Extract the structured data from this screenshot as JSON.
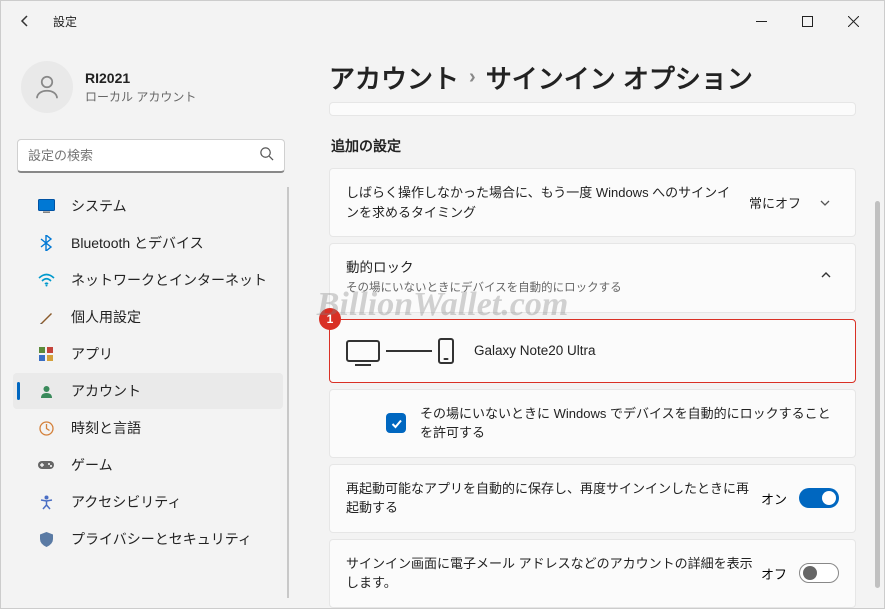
{
  "titlebar": {
    "title": "設定"
  },
  "profile": {
    "name": "RI2021",
    "type": "ローカル アカウント"
  },
  "search": {
    "placeholder": "設定の検索"
  },
  "nav": {
    "items": [
      {
        "label": "システム"
      },
      {
        "label": "Bluetooth とデバイス"
      },
      {
        "label": "ネットワークとインターネット"
      },
      {
        "label": "個人用設定"
      },
      {
        "label": "アプリ"
      },
      {
        "label": "アカウント"
      },
      {
        "label": "時刻と言語"
      },
      {
        "label": "ゲーム"
      },
      {
        "label": "アクセシビリティ"
      },
      {
        "label": "プライバシーとセキュリティ"
      }
    ]
  },
  "breadcrumb": {
    "parent": "アカウント",
    "current": "サインイン オプション"
  },
  "section": {
    "additional": "追加の設定"
  },
  "cards": {
    "idle": {
      "text": "しばらく操作しなかった場合に、もう一度 Windows へのサインインを求めるタイミング",
      "value": "常にオフ"
    },
    "dynlock": {
      "title": "動的ロック",
      "sub": "その場にいないときにデバイスを自動的にロックする"
    },
    "paired": {
      "device": "Galaxy Note20 Ultra",
      "badge": "1"
    },
    "allow": {
      "text": "その場にいないときに Windows でデバイスを自動的にロックすることを許可する"
    },
    "restart": {
      "text": "再起動可能なアプリを自動的に保存し、再度サインインしたときに再起動する",
      "state": "オン"
    },
    "email": {
      "text": "サインイン画面に電子メール アドレスなどのアカウントの詳細を表示します。",
      "state": "オフ"
    }
  },
  "watermark": "BillionWallet.com"
}
